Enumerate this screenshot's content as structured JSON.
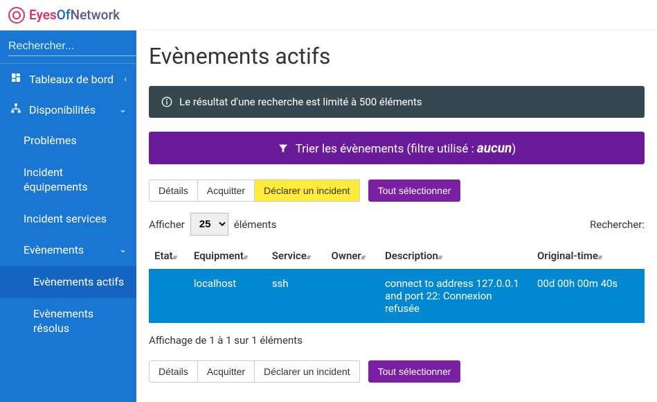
{
  "brand": {
    "eyes": "Eyes",
    "of": "Of",
    "net": "Network"
  },
  "sidebar": {
    "search_placeholder": "Rechercher...",
    "items": [
      {
        "label": "Tableaux de bord",
        "icon": "dashboard"
      },
      {
        "label": "Disponibilités",
        "icon": "sitemap"
      }
    ],
    "disp_children": [
      {
        "label": "Problèmes"
      },
      {
        "label": "Incident équipements"
      },
      {
        "label": "Incident services"
      },
      {
        "label": "Evènements"
      }
    ],
    "ev_children": [
      {
        "label": "Evènements actifs"
      },
      {
        "label": "Evènements résolus"
      }
    ]
  },
  "page": {
    "title": "Evènements actifs",
    "info": "Le résultat d'une recherche est limité à 500 éléments",
    "filter_prefix": "Trier les évènements (filtre utilisé : ",
    "filter_name": "aucun",
    "filter_suffix": ")",
    "buttons": {
      "details": "Détails",
      "ack": "Acquitter",
      "declare": "Déclarer un incident",
      "select_all": "Tout sélectionner"
    },
    "show_label": "Afficher",
    "show_value": "25",
    "show_suffix": "éléments",
    "search_label": "Rechercher:",
    "columns": {
      "etat": "Etat",
      "equipment": "Equipment",
      "service": "Service",
      "owner": "Owner",
      "description": "Description",
      "time": "Original-time"
    },
    "rows": [
      {
        "etat": "",
        "equipment": "localhost",
        "service": "ssh",
        "owner": "",
        "description": "connect to address 127.0.0.1 and port 22: Connexion refusée",
        "time": "00d 00h 00m 40s"
      }
    ],
    "table_info": "Affichage de 1 à 1 sur 1 éléments"
  }
}
